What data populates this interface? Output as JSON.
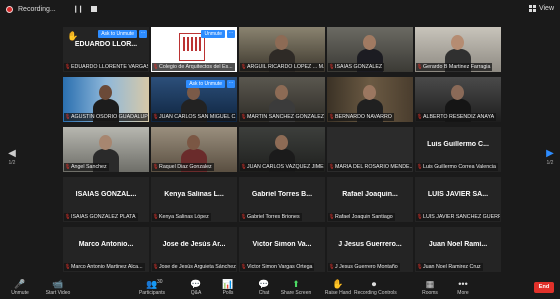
{
  "topbar": {
    "recording_label": "Recording...",
    "pause_icon": "pause-icon",
    "view_label": "View"
  },
  "colors": {
    "accent": "#2d8cff",
    "end": "#e0312a",
    "active_border": "#4cd964",
    "tile_bg": "#242424"
  },
  "tiles": [
    {
      "name": "EDUARDO LLORENTE VARGAS",
      "big_name": "EDUARDO LLOR...",
      "badge": "Ask to Unmute",
      "hand_raised": true,
      "video": false
    },
    {
      "name": "Colegio de Arquitectos del Es...",
      "badge": "Unmute",
      "video": true,
      "logo": true
    },
    {
      "name": "ARGUIL RICARDO LOPEZ ... M...",
      "video": true
    },
    {
      "name": "ISAIAS GONZALEZ",
      "video": true,
      "active": true
    },
    {
      "name": "Gerardo B Martinez Farragia",
      "video": true
    },
    {
      "name": "AGUSTIN OSORIO GUADALUPE",
      "video": true
    },
    {
      "name": "JUAN CARLOS SAN MIGUEL C...",
      "badge": "Ask to Unmute",
      "video": true
    },
    {
      "name": "MARTIN SANCHEZ GONZALEZ",
      "video": true
    },
    {
      "name": "BERNARDO NAVARRO",
      "video": true
    },
    {
      "name": "ALBERTO RESENDIZ ANAYA",
      "video": true
    },
    {
      "name": "Angel Sanchez",
      "video": true
    },
    {
      "name": "Raquel Diaz Gonzalez",
      "video": true
    },
    {
      "name": "JUAN CARLOS VAZQUEZ JIME...",
      "video": true
    },
    {
      "name": "MARIA DEL ROSARIO MENDE...",
      "video": true,
      "dark": true
    },
    {
      "name": "Luis Guillermo Correa Valencia",
      "big_name": "Luis Guillermo C...",
      "video": false
    },
    {
      "name": "ISAIAS GONZALEZ PLATA",
      "big_name": "ISAIAS GONZAL...",
      "video": false
    },
    {
      "name": "Kenya Salinas López",
      "big_name": "Kenya Salinas L...",
      "video": false
    },
    {
      "name": "Gabriel Torres Briones",
      "big_name": "Gabriel Torres B...",
      "video": false
    },
    {
      "name": "Rafael Joaquin Santiago",
      "big_name": "Rafael Joaquin...",
      "video": false
    },
    {
      "name": "LUIS JAVIER SANCHEZ GUERR...",
      "big_name": "LUIS JAVIER SA...",
      "video": false
    },
    {
      "name": "Marco Antonio Martinez Alca...",
      "big_name": "Marco Antonio...",
      "video": false
    },
    {
      "name": "Jose de Jesús Arguieta Sánchez",
      "big_name": "Jose de Jesús Ar...",
      "video": false
    },
    {
      "name": "Victor Simon Vargas Ortega",
      "big_name": "Victor Simon Va...",
      "video": false
    },
    {
      "name": "J Jesus Guerrero Montaño",
      "big_name": "J Jesus Guerrero...",
      "video": false
    },
    {
      "name": "Juan Noel Ramirez Cruz",
      "big_name": "Juan Noel Rami...",
      "video": false
    }
  ],
  "pager": {
    "left_label": "1/2",
    "right_label": "1/2"
  },
  "toolbar": [
    {
      "label": "Unmute",
      "icon": "microphone-muted-icon",
      "glyph": "🎤",
      "red": true
    },
    {
      "label": "Start Video",
      "icon": "video-off-icon",
      "glyph": "📹",
      "red": true
    },
    {
      "label": "Participants",
      "icon": "participants-icon",
      "glyph": "👥",
      "count": "30"
    },
    {
      "label": "Q&A",
      "icon": "qa-icon",
      "glyph": "💬"
    },
    {
      "label": "Polls",
      "icon": "polls-icon",
      "glyph": "📊"
    },
    {
      "label": "Chat",
      "icon": "chat-icon",
      "glyph": "💬"
    },
    {
      "label": "Share Screen",
      "icon": "share-screen-icon",
      "glyph": "⬆",
      "green": true
    },
    {
      "label": "Raise Hand",
      "icon": "raise-hand-icon",
      "glyph": "✋"
    },
    {
      "label": "Recording Controls",
      "icon": "recording-controls-icon",
      "glyph": "⏺"
    },
    {
      "label": "Rooms",
      "icon": "rooms-icon",
      "glyph": "▦"
    },
    {
      "label": "More",
      "icon": "more-icon",
      "glyph": "•••"
    }
  ],
  "end_label": "End"
}
